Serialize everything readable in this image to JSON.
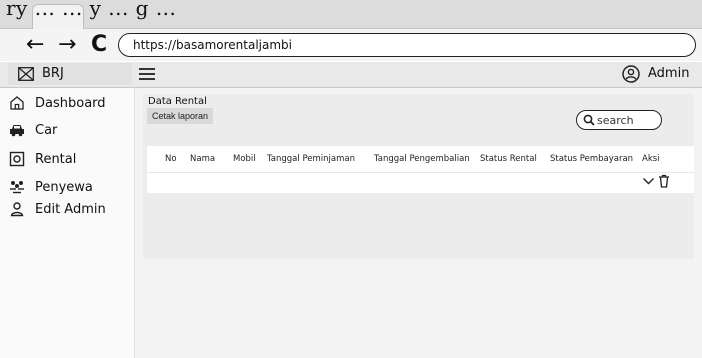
{
  "page_caption": "ry ... ... y ... g ...",
  "browser": {
    "url": "https://basamorentaljambi",
    "back_icon": "←",
    "forward_icon": "→",
    "reload_icon": "C"
  },
  "app": {
    "brand": "BRJ",
    "user": "Admin"
  },
  "sidebar": {
    "items": [
      {
        "label": "Dashboard",
        "icon": "home-icon"
      },
      {
        "label": "Car",
        "icon": "car-icon"
      },
      {
        "label": "Rental",
        "icon": "rental-icon"
      },
      {
        "label": "Penyewa",
        "icon": "users-icon"
      },
      {
        "label": "Edit Admin",
        "icon": "user-icon"
      }
    ]
  },
  "main": {
    "title": "Data Rental",
    "print_button": "Cetak laporan",
    "search_placeholder": "search",
    "columns": [
      "No",
      "Nama",
      "Mobil",
      "Tanggal Peminjaman",
      "Tanggal Pengembalian",
      "Status Rental",
      "Status Pembayaran",
      "Aksi"
    ]
  },
  "colors": {
    "header_bg": "#e9e9e9",
    "content_bg": "#f3f3f3",
    "panel_bg": "#ececec"
  }
}
